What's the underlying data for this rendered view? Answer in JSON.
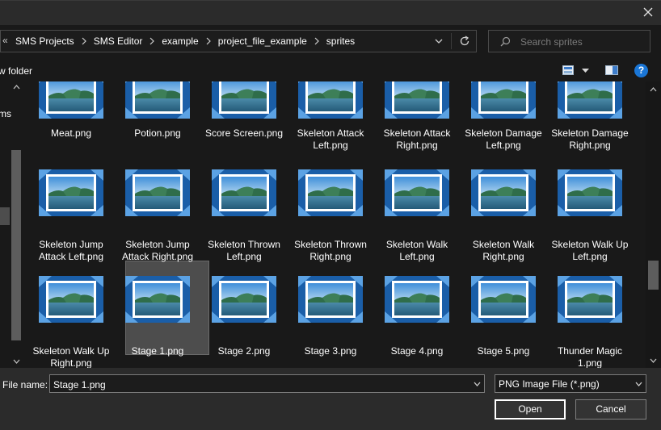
{
  "titlebar": {
    "close_icon": "close-icon"
  },
  "address": {
    "overflow_chevron": "«",
    "crumbs": [
      "SMS Projects",
      "SMS Editor",
      "example",
      "project_file_example",
      "sprites"
    ]
  },
  "search": {
    "placeholder": "Search sprites"
  },
  "toolbar": {
    "new_folder_label": "w folder",
    "help_label": "?"
  },
  "nav": {
    "partial_label": "ms"
  },
  "files": [
    {
      "line1": "Meat.png",
      "line2": ""
    },
    {
      "line1": "Potion.png",
      "line2": ""
    },
    {
      "line1": "Score Screen.png",
      "line2": ""
    },
    {
      "line1": "Skeleton Attack",
      "line2": "Left.png"
    },
    {
      "line1": "Skeleton Attack",
      "line2": "Right.png"
    },
    {
      "line1": "Skeleton Damage",
      "line2": "Left.png"
    },
    {
      "line1": "Skeleton Damage",
      "line2": "Right.png"
    },
    {
      "line1": "Skeleton Jump",
      "line2": "Attack Left.png"
    },
    {
      "line1": "Skeleton Jump",
      "line2": "Attack Right.png"
    },
    {
      "line1": "Skeleton Thrown",
      "line2": "Left.png"
    },
    {
      "line1": "Skeleton Thrown",
      "line2": "Right.png"
    },
    {
      "line1": "Skeleton Walk",
      "line2": "Left.png"
    },
    {
      "line1": "Skeleton Walk",
      "line2": "Right.png"
    },
    {
      "line1": "Skeleton Walk Up",
      "line2": "Left.png"
    },
    {
      "line1": "Skeleton Walk Up",
      "line2": "Right.png"
    },
    {
      "line1": "Stage 1.png",
      "line2": ""
    },
    {
      "line1": "Stage 2.png",
      "line2": ""
    },
    {
      "line1": "Stage 3.png",
      "line2": ""
    },
    {
      "line1": "Stage 4.png",
      "line2": ""
    },
    {
      "line1": "Stage 5.png",
      "line2": ""
    },
    {
      "line1": "Thunder Magic",
      "line2": "1.png"
    }
  ],
  "selected_file": "Stage 1.png",
  "bottom": {
    "file_name_label": "File name:",
    "file_name_value": "Stage 1.png",
    "file_type_value": "PNG Image File (*.png)",
    "open_label": "Open",
    "cancel_label": "Cancel"
  },
  "colors": {
    "background": "#191919",
    "selection": "#4d4d4d",
    "accent": "#1a76d6"
  }
}
